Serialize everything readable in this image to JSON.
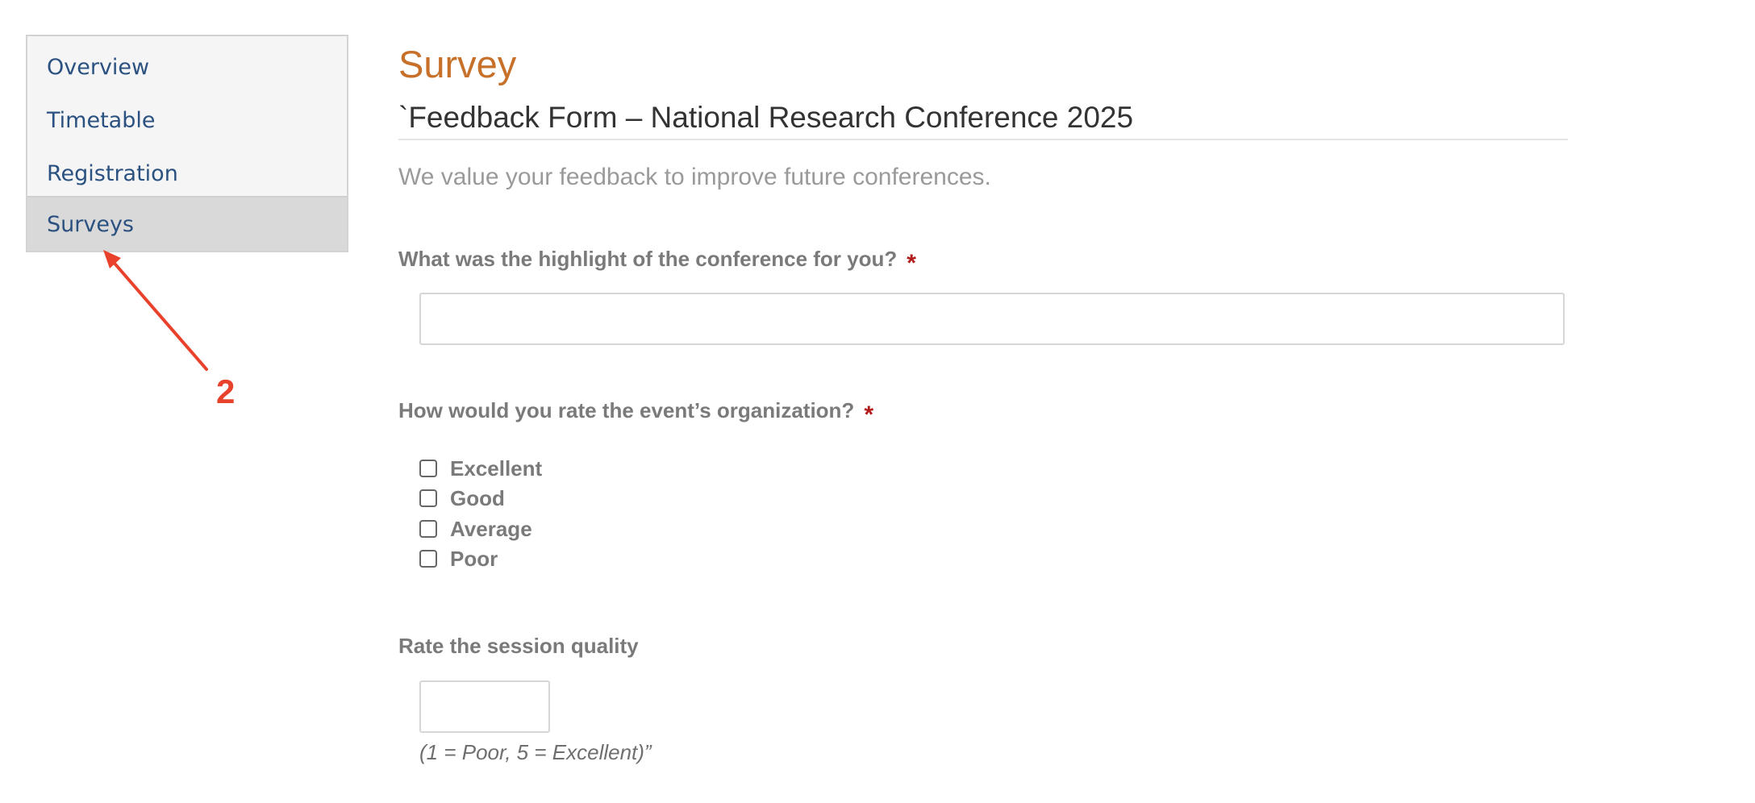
{
  "sidebar": {
    "items": [
      {
        "label": "Overview",
        "active": false
      },
      {
        "label": "Timetable",
        "active": false
      },
      {
        "label": "Registration",
        "active": false
      },
      {
        "label": "Surveys",
        "active": true
      }
    ]
  },
  "annotation": {
    "number": "2",
    "color": "#e8422c"
  },
  "main": {
    "heading": "Survey",
    "form_title": "`Feedback Form – National Research Conference 2025",
    "description": "We value your feedback to improve future conferences.",
    "questions": [
      {
        "label": "What was the highlight of the conference for you?",
        "required_mark": "*",
        "type": "text",
        "value": ""
      },
      {
        "label": "How would you rate the event’s organization?",
        "required_mark": "*",
        "type": "checkbox",
        "options": [
          {
            "label": "Excellent",
            "checked": false
          },
          {
            "label": "Good",
            "checked": false
          },
          {
            "label": "Average",
            "checked": false
          },
          {
            "label": "Poor",
            "checked": false
          }
        ]
      },
      {
        "label": "Rate the session quality",
        "type": "number",
        "value": "",
        "hint": "(1 = Poor, 5 = Excellent)”"
      }
    ]
  },
  "colors": {
    "heading": "#c6702a",
    "link": "#2a5180",
    "required": "#b31b1b",
    "label": "#7a7a7a"
  }
}
